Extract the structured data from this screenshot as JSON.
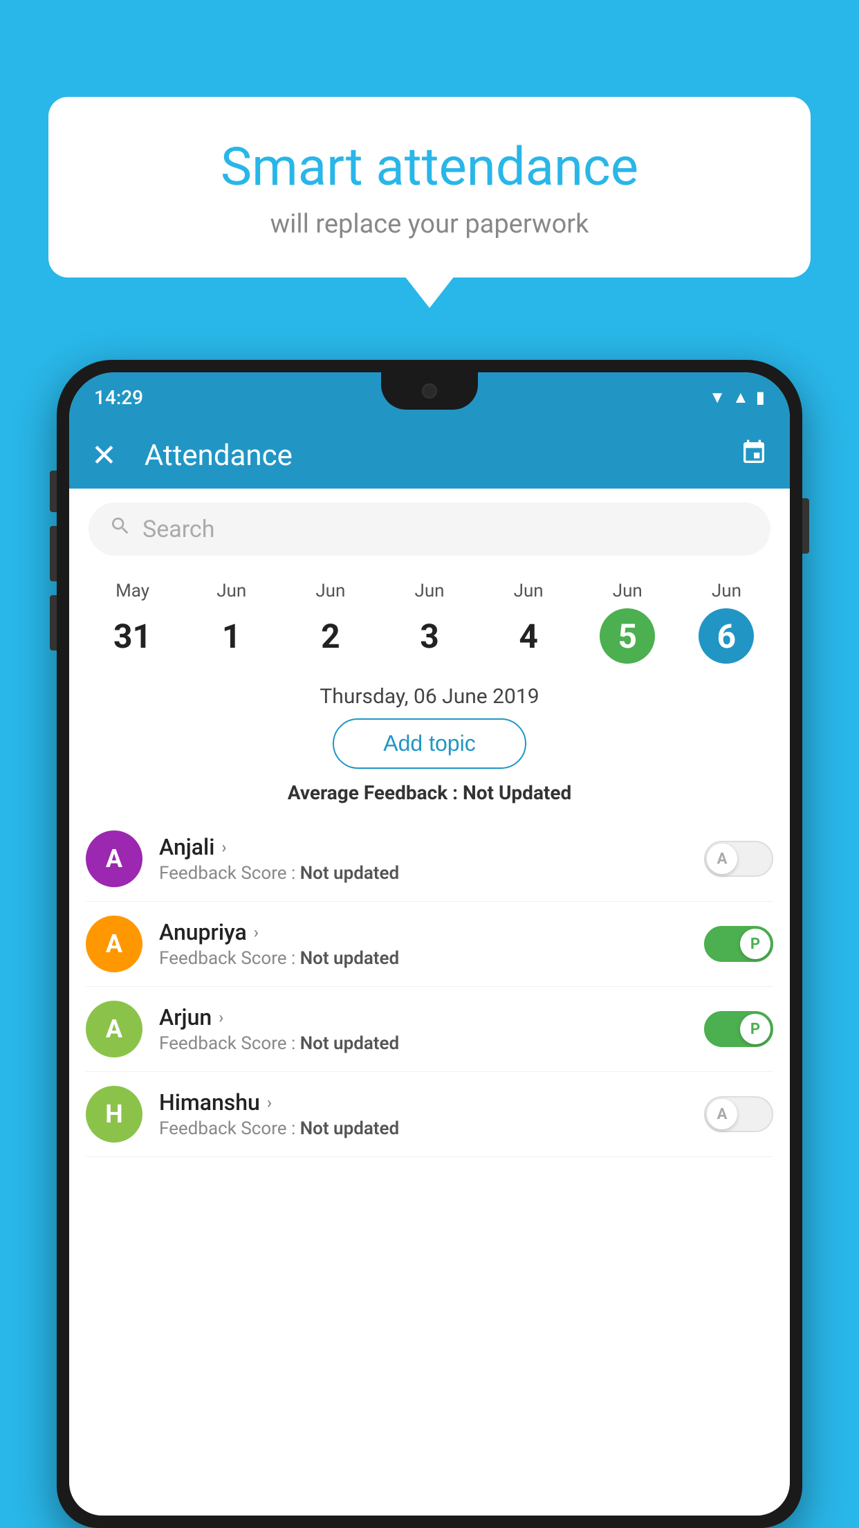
{
  "background_color": "#29b6e8",
  "bubble": {
    "title": "Smart attendance",
    "subtitle": "will replace your paperwork"
  },
  "phone": {
    "status_bar": {
      "time": "14:29",
      "icons": [
        "wifi",
        "signal",
        "battery"
      ]
    },
    "app_bar": {
      "title": "Attendance",
      "close_label": "✕",
      "calendar_icon": "📅"
    },
    "search": {
      "placeholder": "Search"
    },
    "dates": [
      {
        "month": "May",
        "day": "31",
        "style": "normal"
      },
      {
        "month": "Jun",
        "day": "1",
        "style": "normal"
      },
      {
        "month": "Jun",
        "day": "2",
        "style": "normal"
      },
      {
        "month": "Jun",
        "day": "3",
        "style": "normal"
      },
      {
        "month": "Jun",
        "day": "4",
        "style": "normal"
      },
      {
        "month": "Jun",
        "day": "5",
        "style": "today"
      },
      {
        "month": "Jun",
        "day": "6",
        "style": "selected"
      }
    ],
    "selected_date": "Thursday, 06 June 2019",
    "add_topic_label": "Add topic",
    "avg_feedback_label": "Average Feedback :",
    "avg_feedback_value": "Not Updated",
    "students": [
      {
        "name": "Anjali",
        "avatar_letter": "A",
        "avatar_color": "#9c27b0",
        "feedback_label": "Feedback Score :",
        "feedback_value": "Not updated",
        "toggle_state": "off",
        "toggle_letter": "A"
      },
      {
        "name": "Anupriya",
        "avatar_letter": "A",
        "avatar_color": "#ff9800",
        "feedback_label": "Feedback Score :",
        "feedback_value": "Not updated",
        "toggle_state": "on",
        "toggle_letter": "P"
      },
      {
        "name": "Arjun",
        "avatar_letter": "A",
        "avatar_color": "#8bc34a",
        "feedback_label": "Feedback Score :",
        "feedback_value": "Not updated",
        "toggle_state": "on",
        "toggle_letter": "P"
      },
      {
        "name": "Himanshu",
        "avatar_letter": "H",
        "avatar_color": "#8bc34a",
        "feedback_label": "Feedback Score :",
        "feedback_value": "Not updated",
        "toggle_state": "off",
        "toggle_letter": "A"
      }
    ]
  }
}
